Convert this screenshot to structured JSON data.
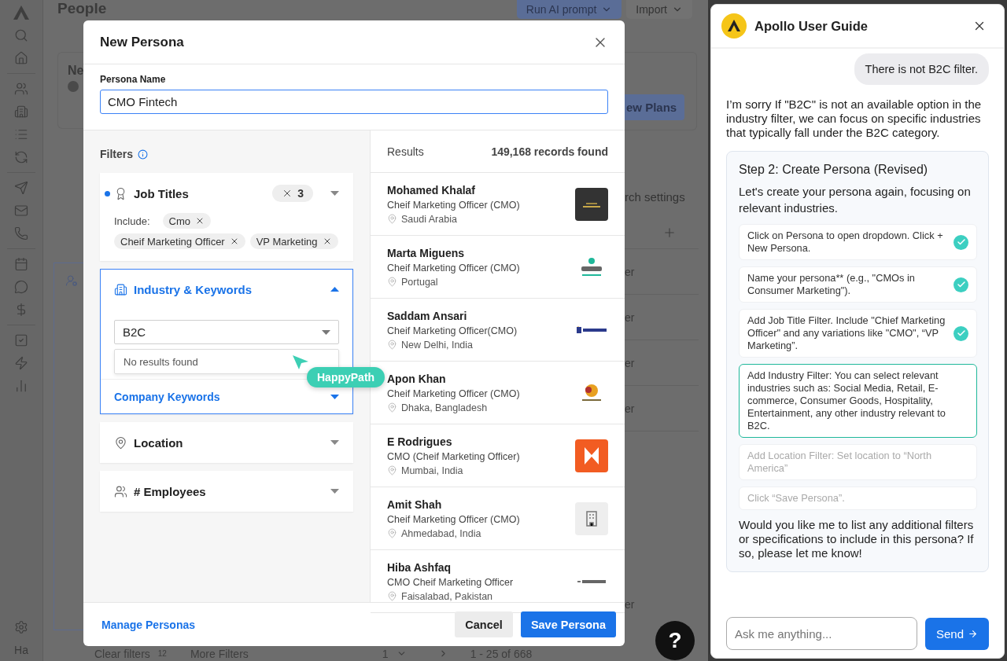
{
  "app": {
    "title": "People",
    "toolbar": [
      {
        "label": "Run AI prompt",
        "kind": "primary"
      },
      {
        "label": "Import",
        "kind": "secondary"
      }
    ],
    "sidebar": {
      "footer": "Ha"
    },
    "banner": {
      "title": "Ne",
      "button": "ew Plans"
    },
    "search_settings": "rch settings",
    "row_fragments": [
      "er",
      "er",
      "er",
      "er"
    ],
    "last_row_fragment": "er",
    "footer": {
      "clear_filters": "Clear filters",
      "filter_count": "12",
      "more_filters": "More Filters",
      "page": "1",
      "range": "1 - 25 of 668"
    }
  },
  "modal": {
    "title": "New Persona",
    "name_label": "Persona Name",
    "name_value": "CMO Fintech",
    "filters_title": "Filters",
    "filters": [
      {
        "kind": "job_titles",
        "title": "Job Titles",
        "active": true,
        "expanded": false,
        "count": "3",
        "include_label": "Include:",
        "chips": [
          "Cmo",
          "Cheif Marketing Officer",
          "VP Marketing"
        ]
      },
      {
        "kind": "industry",
        "title": "Industry & Keywords",
        "active": false,
        "expanded": true,
        "select_value": "B2C",
        "dropdown_message": "No results found",
        "sub_title": "Company Keywords"
      },
      {
        "kind": "location",
        "title": "Location",
        "active": false,
        "expanded": false
      },
      {
        "kind": "employees",
        "title": "# Employees",
        "active": false,
        "expanded": false
      }
    ],
    "results_title": "Results",
    "results_count": "149,168 records found",
    "results": [
      {
        "name": "Mohamed Khalaf",
        "title": "Cheif Marketing Officer (CMO)",
        "location": "Saudi Arabia",
        "kind": "dark"
      },
      {
        "name": "Marta Miguens",
        "title": "Cheif Marketing Officer (CMO)",
        "location": "Portugal",
        "kind": "bubble"
      },
      {
        "name": "Saddam Ansari",
        "title": "Cheif Marketing Officer(CMO)",
        "location": "New Delhi, India",
        "kind": "cart"
      },
      {
        "name": "Apon Khan",
        "title": "Cheif Marketing Officer (CMO)",
        "location": "Dhaka, Bangladesh",
        "kind": "emblem"
      },
      {
        "name": "E Rodrigues",
        "title": "CMO (Cheif Marketing Officer)",
        "location": "Mumbai, India",
        "kind": "orange"
      },
      {
        "name": "Amit Shah",
        "title": "Cheif Marketing Officer (CMO)",
        "location": "Ahmedabad, India",
        "kind": "building"
      },
      {
        "name": "Hiba Ashfaq",
        "title": "CMO Cheif Marketing Officer",
        "location": "Faisalabad, Pakistan",
        "kind": "wordmark"
      }
    ],
    "manage_link": "Manage Personas",
    "cancel": "Cancel",
    "save": "Save Persona"
  },
  "tooltip": {
    "label": "HappyPath"
  },
  "help_button": {
    "label": "?"
  },
  "chat": {
    "title": "Apollo User Guide",
    "user_message": "There is not B2C filter.",
    "reply": "I’m sorry If \"B2C\" is not an available option in the industry filter, we can focus on specific industries that typically fall under the B2C category.",
    "card": {
      "title": "Step 2: Create Persona (Revised)",
      "intro": "Let's create your persona again, focusing on relevant industries.",
      "steps": [
        {
          "text": "Click on Persona to open dropdown. Click + New Persona.",
          "kind": "done"
        },
        {
          "text": "Name your persona** (e.g., \"CMOs in Consumer Marketing\").",
          "kind": "done"
        },
        {
          "text": "Add Job Title Filter. Include \"Chief Marketing Officer\" and any variations like \"CMO\", “VP Marketing”.",
          "kind": "done"
        },
        {
          "text": "Add Industry Filter: You can select relevant industries such as: Social Media, Retail, E-commerce, Consumer Goods, Hospitality, Entertainment, any other industry relevant to B2C.",
          "kind": "current"
        },
        {
          "text": "Add Location Filter: Set location to “North America”",
          "kind": "pending"
        },
        {
          "text": "Click “Save Persona”.",
          "kind": "pending"
        }
      ],
      "outro": "Would you like me to list any additional filters or specifications to include in this persona? If so, please let me know!"
    },
    "input_placeholder": "Ask me anything...",
    "send": "Send"
  }
}
